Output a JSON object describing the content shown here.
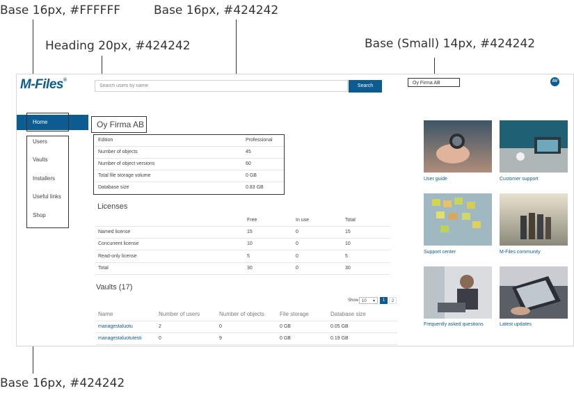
{
  "annotations": {
    "nav_text": "Base 16px, #FFFFFF",
    "table_text": "Base 16px, #424242",
    "heading": "Heading 20px, #424242",
    "small": "Base (Small) 14px, #424242",
    "bottom": "Base 16px, #424242"
  },
  "header": {
    "logo": "M-Files",
    "logo_mark": "®",
    "search_placeholder": "Search users by name",
    "search_button": "Search",
    "org_selector": "Oy Firma AB",
    "avatar_initials": "AV"
  },
  "sidebar": {
    "items": [
      "Home",
      "Users",
      "Vaults",
      "Installers",
      "Useful links",
      "Shop"
    ]
  },
  "overview": {
    "title": "Oy Firma AB",
    "rows": [
      {
        "label": "Edition",
        "value": "Professional"
      },
      {
        "label": "Number of objects",
        "value": "45"
      },
      {
        "label": "Number of object versions",
        "value": "60"
      },
      {
        "label": "Total file storage volume",
        "value": "0 GB"
      },
      {
        "label": "Database size",
        "value": "0.83 GB"
      }
    ]
  },
  "licenses": {
    "title": "Licenses",
    "headers": [
      "Free",
      "In use",
      "Total"
    ],
    "rows": [
      {
        "label": "Named license",
        "free": "15",
        "in_use": "0",
        "total": "15"
      },
      {
        "label": "Concurrent license",
        "free": "10",
        "in_use": "0",
        "total": "10"
      },
      {
        "label": "Read-only license",
        "free": "5",
        "in_use": "0",
        "total": "5"
      },
      {
        "label": "Total",
        "free": "30",
        "in_use": "0",
        "total": "30"
      }
    ]
  },
  "vaults": {
    "title": "Vaults (17)",
    "show_label": "Show",
    "page_size": "10",
    "pages": [
      "1",
      "2"
    ],
    "headers": [
      "Name",
      "Number of users",
      "Number of objects",
      "File storage",
      "Database size"
    ],
    "rows": [
      {
        "name": "managestaluotu",
        "users": "2",
        "objects": "0",
        "storage": "0 GB",
        "db": "0.05 GB"
      },
      {
        "name": "managestaluotutesti",
        "users": "0",
        "objects": "9",
        "storage": "0 GB",
        "db": "0.19 GB"
      }
    ]
  },
  "tiles": [
    {
      "label": "User guide",
      "icon": "compass-photo"
    },
    {
      "label": "Customer support",
      "icon": "laptop-desk-photo"
    },
    {
      "label": "Support center",
      "icon": "sticky-notes-photo"
    },
    {
      "label": "M-Files community",
      "icon": "group-people-photo"
    },
    {
      "label": "Frequently asked questions",
      "icon": "man-laptop-photo"
    },
    {
      "label": "Latest updates",
      "icon": "hands-laptop-photo"
    }
  ],
  "colors": {
    "brand": "#0d5c91",
    "text": "#424242",
    "white": "#FFFFFF"
  }
}
